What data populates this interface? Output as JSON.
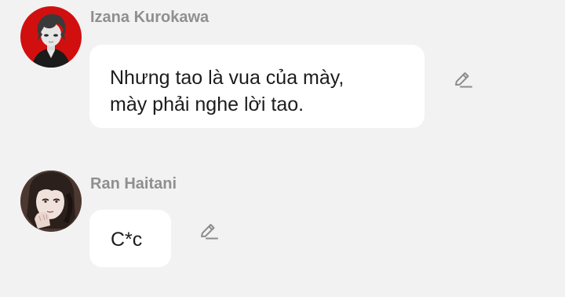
{
  "messages": [
    {
      "sender": "Izana Kurokawa",
      "lines": [
        "Nhưng tao là vua của mày,",
        "mày phải nghe lời tao."
      ],
      "avatar_icon": "red-dark-character-avatar",
      "edit_icon": "pencil-edit-icon"
    },
    {
      "sender": "Ran Haitani",
      "lines": [
        "C*c"
      ],
      "avatar_icon": "braided-character-avatar",
      "edit_icon": "pencil-edit-icon"
    }
  ],
  "colors": {
    "background": "#f2f2f2",
    "bubble": "#ffffff",
    "sender_name": "#8f8f8f",
    "message_text": "#1c1c1c",
    "icon": "#8c8c8c",
    "avatar1_bg": "#d10f0f"
  }
}
